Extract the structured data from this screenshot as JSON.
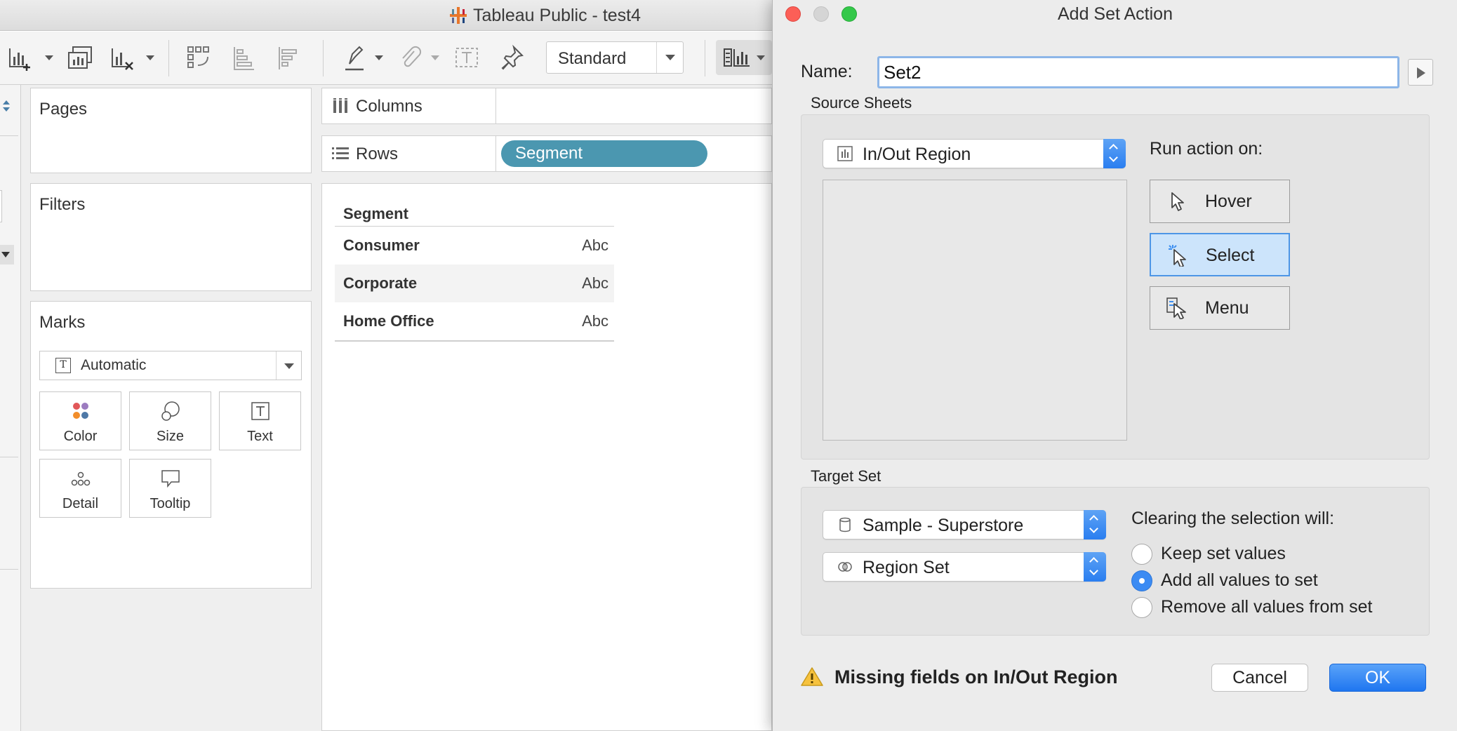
{
  "app": {
    "title": "Tableau Public - test4"
  },
  "toolbar": {
    "fit_value": "Standard"
  },
  "shelves": {
    "pages": "Pages",
    "filters": "Filters",
    "marks": "Marks",
    "columns": "Columns",
    "rows": "Rows",
    "rows_pill": "Segment"
  },
  "marks": {
    "type": "Automatic",
    "buttons": [
      "Color",
      "Size",
      "Text",
      "Detail",
      "Tooltip"
    ]
  },
  "view": {
    "header": "Segment",
    "rows": [
      {
        "name": "Consumer",
        "value": "Abc"
      },
      {
        "name": "Corporate",
        "value": "Abc"
      },
      {
        "name": "Home Office",
        "value": "Abc"
      }
    ]
  },
  "dialog": {
    "title": "Add Set Action",
    "name_label": "Name:",
    "name_value": "Set2",
    "source_sheets_label": "Source Sheets",
    "source_sheet": "In/Out Region",
    "run_action_label": "Run action on:",
    "run_options": [
      {
        "label": "Hover",
        "selected": false,
        "icon": "pointer-icon"
      },
      {
        "label": "Select",
        "selected": true,
        "icon": "select-click-icon"
      },
      {
        "label": "Menu",
        "selected": false,
        "icon": "menu-pointer-icon"
      }
    ],
    "target_set_label": "Target Set",
    "data_source": "Sample - Superstore",
    "target_set": "Region Set",
    "clearing_label": "Clearing the selection will:",
    "clearing_options": [
      {
        "label": "Keep set values",
        "selected": false
      },
      {
        "label": "Add all values to set",
        "selected": true
      },
      {
        "label": "Remove all values from set",
        "selected": false
      }
    ],
    "warning": "Missing fields on In/Out Region",
    "cancel_label": "Cancel",
    "ok_label": "OK"
  },
  "colors": {
    "pill": "#4b97b0",
    "accent": "#3b8bf3",
    "selected_bg": "#cce4fb"
  }
}
